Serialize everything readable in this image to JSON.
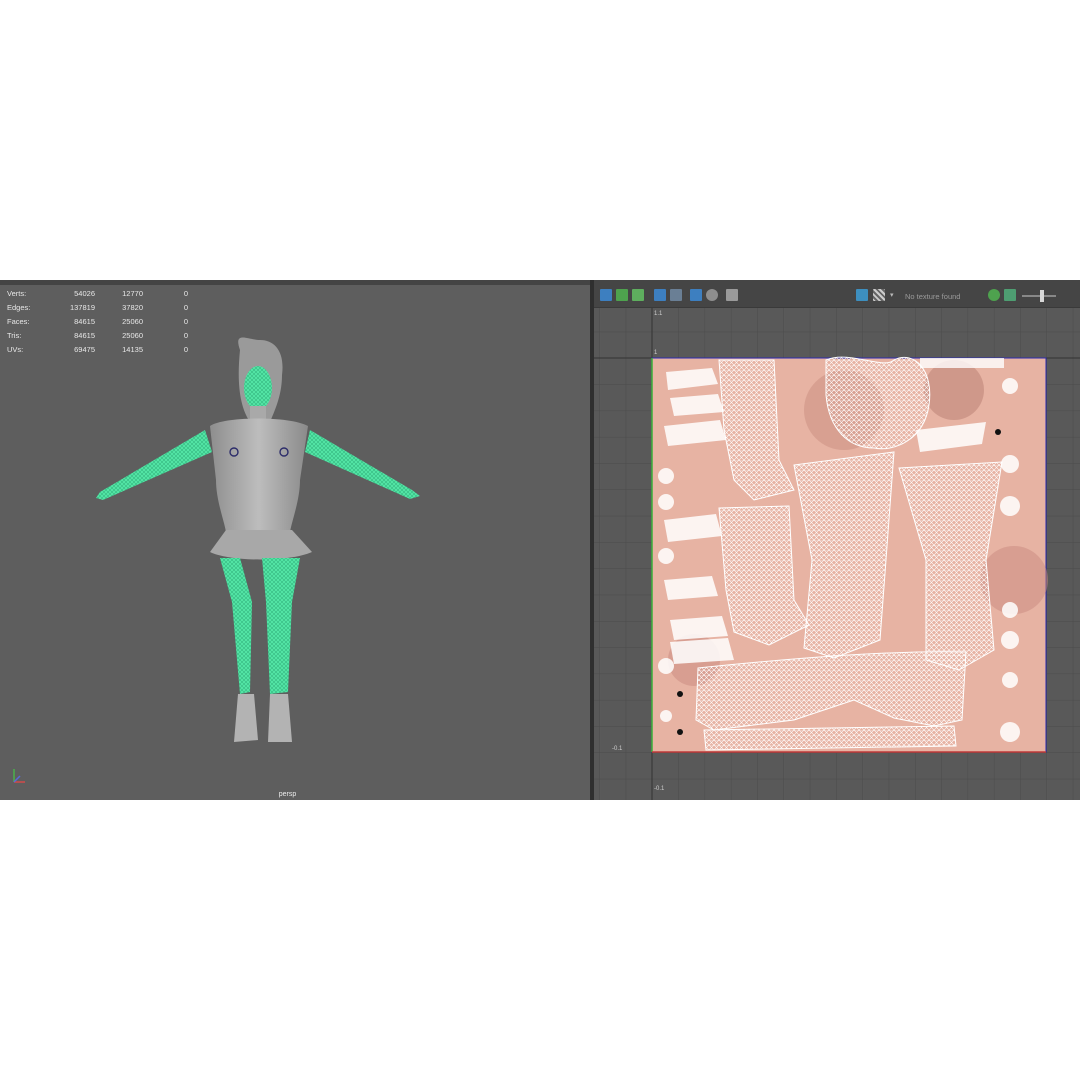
{
  "viewport3d": {
    "stats": [
      {
        "label": "Verts:",
        "v1": "54026",
        "v2": "12770",
        "v3": "0"
      },
      {
        "label": "Edges:",
        "v1": "137819",
        "v2": "37820",
        "v3": "0"
      },
      {
        "label": "Faces:",
        "v1": "84615",
        "v2": "25060",
        "v3": "0"
      },
      {
        "label": "Tris:",
        "v1": "84615",
        "v2": "25060",
        "v3": "0"
      },
      {
        "label": "UVs:",
        "v1": "69475",
        "v2": "14135",
        "v3": "0"
      }
    ],
    "camera_label": "persp",
    "selection_color": "#52e3a4",
    "background_color": "#5e5e5e"
  },
  "uv_editor": {
    "texture_status": "No texture found",
    "ticks": {
      "top": "1.1",
      "upper": "1",
      "left": "-0.1",
      "bottom": "-0.1"
    },
    "texture_base_color": "#e8b7a7",
    "wire_color": "#ffffff"
  },
  "icons": {
    "axis": "axis-gizmo-icon",
    "uv_toolbar": [
      "uv-shell-icon",
      "stats-icon",
      "gradient-icon",
      "frame-icon",
      "grid-icon",
      "grid-snap-icon",
      "shaded-icon",
      "snapshot-icon",
      "image-icon",
      "checker-icon",
      "chevron-down-icon",
      "exposure-icon",
      "color-icon"
    ]
  }
}
